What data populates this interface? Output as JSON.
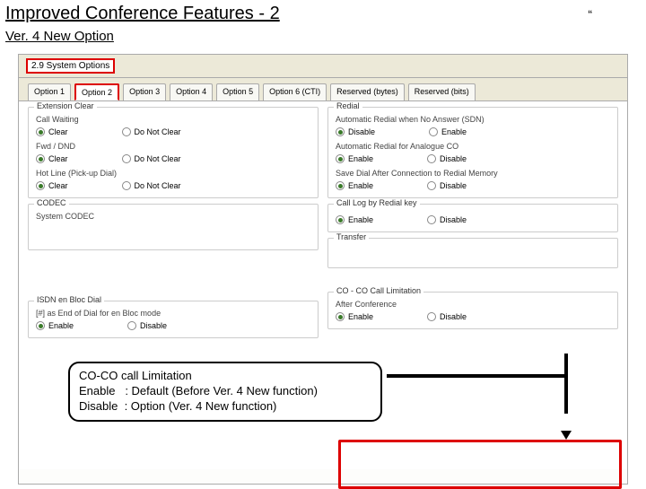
{
  "header": {
    "title": "Improved Conference Features - 2",
    "subtitle": "Ver. 4 New Option",
    "quote": "“"
  },
  "window": {
    "title": "2.9 System Options"
  },
  "tabs": [
    {
      "label": "Option 1"
    },
    {
      "label": "Option 2"
    },
    {
      "label": "Option 3"
    },
    {
      "label": "Option 4"
    },
    {
      "label": "Option 5"
    },
    {
      "label": "Option 6 (CTI)"
    },
    {
      "label": "Reserved (bytes)"
    },
    {
      "label": "Reserved (bits)"
    }
  ],
  "left": {
    "ext_clear": {
      "title": "Extension Clear",
      "call_waiting": {
        "label": "Call Waiting",
        "opt1": "Clear",
        "opt2": "Do Not Clear"
      },
      "fwd_dnd": {
        "label": "Fwd / DND",
        "opt1": "Clear",
        "opt2": "Do Not Clear"
      },
      "hotline": {
        "label": "Hot Line (Pick-up Dial)",
        "opt1": "Clear",
        "opt2": "Do Not Clear"
      }
    },
    "codec": {
      "title": "CODEC",
      "label": "System CODEC"
    },
    "isdn": {
      "title": "ISDN en Bloc Dial",
      "label": "[#] as End of Dial for en Bloc mode",
      "opt1": "Enable",
      "opt2": "Disable"
    }
  },
  "right": {
    "redial": {
      "title": "Redial",
      "auto_sdn": {
        "label": "Automatic Redial when No Answer (SDN)",
        "opt1": "Disable",
        "opt2": "Enable"
      },
      "auto_analog": {
        "label": "Automatic Redial for Analogue CO",
        "opt1": "Enable",
        "opt2": "Disable"
      },
      "save_dial": {
        "label": "Save Dial After Connection to Redial Memory",
        "opt1": "Enable",
        "opt2": "Disable"
      }
    },
    "calllog": {
      "title": "Call Log by Redial key",
      "opt1": "Enable",
      "opt2": "Disable"
    },
    "trans": {
      "title": "Transfer",
      "opt1": ""
    },
    "coco": {
      "title": "CO - CO Call Limitation",
      "label": "After Conference",
      "opt1": "Enable",
      "opt2": "Disable"
    }
  },
  "callout": {
    "line1": "CO-CO call Limitation",
    "line2": "Enable   : Default (Before Ver. 4 New function)",
    "line3": "Disable  : Option (Ver. 4 New function)"
  }
}
